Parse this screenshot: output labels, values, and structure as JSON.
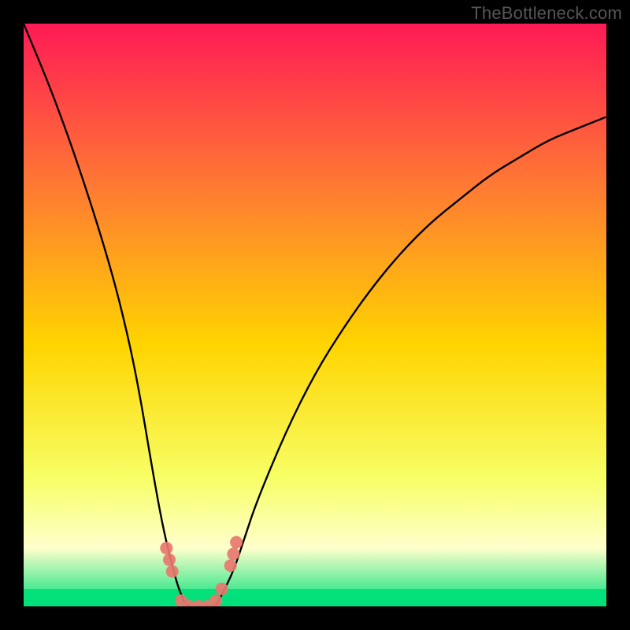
{
  "watermark": "TheBottleneck.com",
  "colors": {
    "frame_bg": "#000000",
    "gradient_top": "#ff1a55",
    "gradient_mid_upper": "#ff7a33",
    "gradient_mid": "#ffd400",
    "gradient_lower": "#f7ff66",
    "gradient_band_pale": "#ffffcc",
    "gradient_bottom_green": "#00e07a",
    "curve": "#000000",
    "markers": "#e8776f"
  },
  "chart_data": {
    "type": "line",
    "title": "",
    "xlabel": "",
    "ylabel": "",
    "xlim": [
      0,
      100
    ],
    "ylim": [
      0,
      100
    ],
    "grid": false,
    "legend": false,
    "curve_comment": "Approximate V-shaped bottleneck curve; y is bottleneck percentage (higher = redder). Values estimated from gradient position.",
    "x": [
      0,
      5,
      10,
      15,
      18,
      20,
      22,
      24,
      26,
      27,
      28,
      29,
      30,
      31,
      32,
      33,
      34,
      36,
      38,
      40,
      45,
      50,
      55,
      60,
      65,
      70,
      75,
      80,
      85,
      90,
      95,
      100
    ],
    "y": [
      100,
      88,
      74,
      58,
      46,
      36,
      24,
      13,
      5,
      2,
      0,
      0,
      0,
      0,
      0,
      0,
      2,
      6,
      12,
      18,
      30,
      40,
      48,
      55,
      61,
      66,
      70,
      74,
      77,
      80,
      82,
      84
    ],
    "markers": {
      "comment": "Pink marker clusters near the valley bottom on both branches.",
      "points": [
        {
          "x": 24.5,
          "y": 10
        },
        {
          "x": 25.0,
          "y": 8
        },
        {
          "x": 25.5,
          "y": 6
        },
        {
          "x": 27.0,
          "y": 1
        },
        {
          "x": 28.5,
          "y": 0
        },
        {
          "x": 30.0,
          "y": 0
        },
        {
          "x": 31.5,
          "y": 0
        },
        {
          "x": 33.0,
          "y": 1
        },
        {
          "x": 34.0,
          "y": 3
        },
        {
          "x": 35.5,
          "y": 7
        },
        {
          "x": 36.0,
          "y": 9
        },
        {
          "x": 36.5,
          "y": 11
        }
      ]
    }
  }
}
